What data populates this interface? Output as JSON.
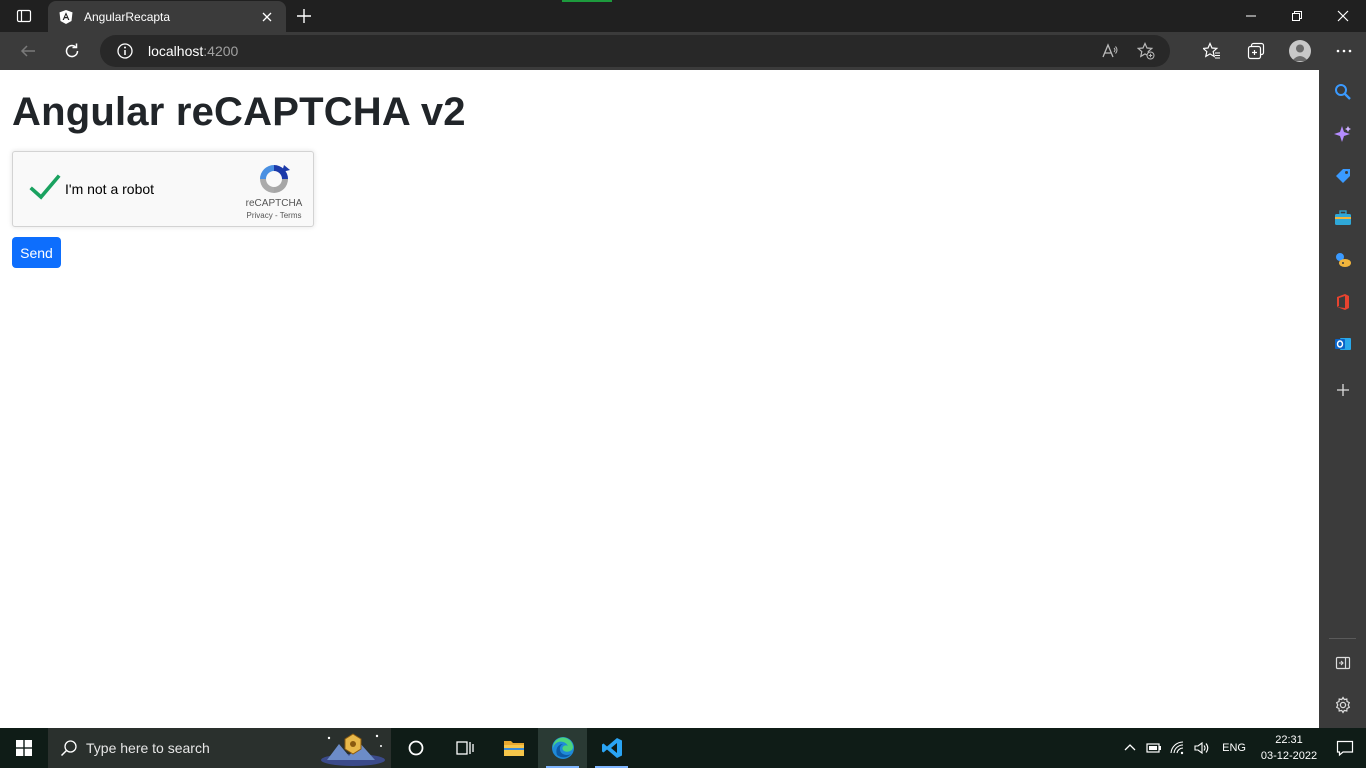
{
  "browser": {
    "tab": {
      "title": "AngularRecapta"
    },
    "address": {
      "host": "localhost",
      "port": ":4200"
    }
  },
  "page": {
    "heading": "Angular reCAPTCHA v2",
    "recaptcha": {
      "label": "I'm not a robot",
      "brand": "reCAPTCHA",
      "links": "Privacy - Terms",
      "checked": true
    },
    "send_label": "Send"
  },
  "taskbar": {
    "search_placeholder": "Type here to search",
    "lang": "ENG",
    "time": "22:31",
    "date": "03-12-2022"
  },
  "colors": {
    "accent_blue": "#0d6efd",
    "check_green": "#1aa260",
    "chrome_dark": "#202020"
  }
}
